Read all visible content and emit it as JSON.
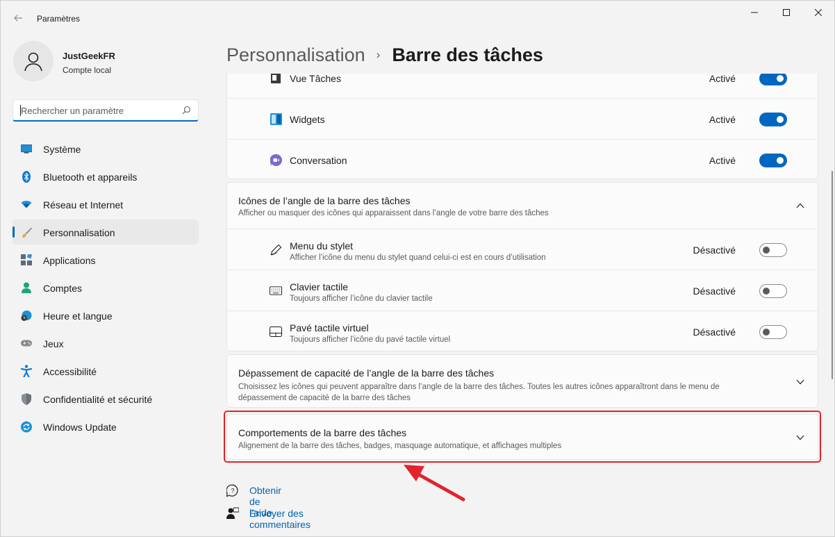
{
  "window": {
    "title": "Paramètres"
  },
  "profile": {
    "name": "JustGeekFR",
    "account_type": "Compte local"
  },
  "search": {
    "placeholder": "Rechercher un paramètre"
  },
  "sidebar": {
    "items": [
      {
        "label": "Système",
        "icon": "system-icon"
      },
      {
        "label": "Bluetooth et appareils",
        "icon": "bluetooth-icon"
      },
      {
        "label": "Réseau et Internet",
        "icon": "wifi-icon"
      },
      {
        "label": "Personnalisation",
        "icon": "brush-icon",
        "active": true
      },
      {
        "label": "Applications",
        "icon": "apps-icon"
      },
      {
        "label": "Comptes",
        "icon": "person-icon"
      },
      {
        "label": "Heure et langue",
        "icon": "clock-globe-icon"
      },
      {
        "label": "Jeux",
        "icon": "gamepad-icon"
      },
      {
        "label": "Accessibilité",
        "icon": "accessibility-icon"
      },
      {
        "label": "Confidentialité et sécurité",
        "icon": "shield-icon"
      },
      {
        "label": "Windows Update",
        "icon": "update-icon"
      }
    ]
  },
  "header": {
    "parent": "Personnalisation",
    "separator": "›",
    "current": "Barre des tâches"
  },
  "taskbar_items": {
    "rows": [
      {
        "label": "Vue Tâches",
        "state": "Activé",
        "on": true,
        "icon": "task-view-icon"
      },
      {
        "label": "Widgets",
        "state": "Activé",
        "on": true,
        "icon": "widgets-icon"
      },
      {
        "label": "Conversation",
        "state": "Activé",
        "on": true,
        "icon": "chat-icon"
      }
    ]
  },
  "corner_icons": {
    "title": "Icônes de l’angle de la barre des tâches",
    "subtitle": "Afficher ou masquer des icônes qui apparaissent dans l’angle de votre barre des tâches",
    "expanded": true,
    "rows": [
      {
        "label": "Menu du stylet",
        "subtitle": "Afficher l’icône du menu du stylet quand celui-ci est en cours d’utilisation",
        "state": "Désactivé",
        "on": false,
        "icon": "pen-icon"
      },
      {
        "label": "Clavier tactile",
        "subtitle": "Toujours afficher l’icône du clavier tactile",
        "state": "Désactivé",
        "on": false,
        "icon": "keyboard-icon"
      },
      {
        "label": "Pavé tactile virtuel",
        "subtitle": "Toujours afficher l’icône du pavé tactile virtuel",
        "state": "Désactivé",
        "on": false,
        "icon": "touchpad-icon"
      }
    ]
  },
  "overflow": {
    "title": "Dépassement de capacité de l’angle de la barre des tâches",
    "subtitle_line1": "Choisissez les icônes qui peuvent apparaître dans l’angle de la barre des tâches. Toutes les autres icônes apparaîtront dans le menu de",
    "subtitle_line2": "dépassement de capacité de la barre des tâches"
  },
  "behaviors": {
    "title": "Comportements de la barre des tâches",
    "subtitle": "Alignement de la barre des tâches, badges, masquage automatique, et affichages multiples"
  },
  "links": {
    "help": "Obtenir de l’aide",
    "feedback": "Envoyer des commentaires"
  },
  "colors": {
    "accent": "#0067c0",
    "highlight": "#e1232b",
    "link": "#0063b1"
  }
}
